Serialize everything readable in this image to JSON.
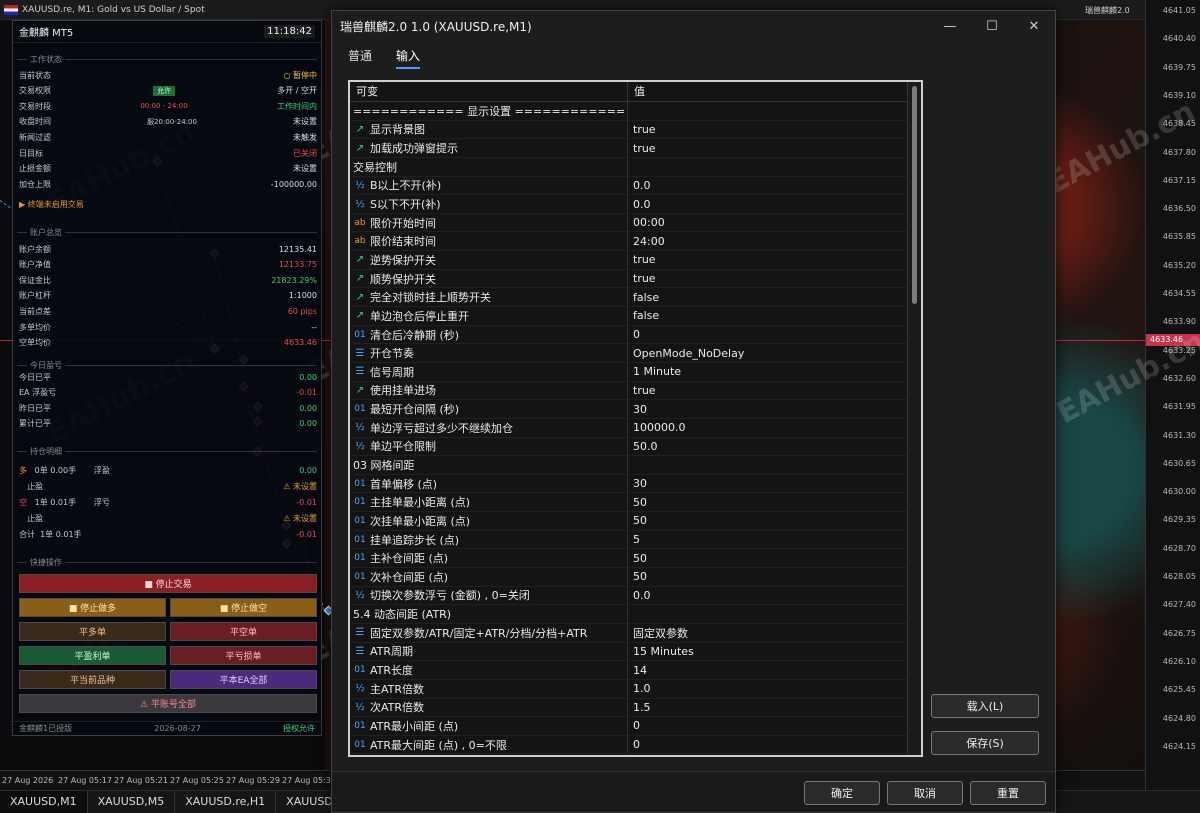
{
  "mt5": {
    "chart_title": "XAUUSD.re, M1:  Gold vs US Dollar / Spot",
    "corner_label": "瑞兽麒麟2.0",
    "prices": [
      "4641.05",
      "4640.40",
      "4639.75",
      "4639.10",
      "4638.45",
      "4637.80",
      "4637.15",
      "4636.50",
      "4635.85",
      "4635.20",
      "4634.55",
      "4633.90",
      "4633.25",
      "4632.60",
      "4631.95",
      "4631.30",
      "4630.65",
      "4630.00",
      "4629.35",
      "4628.70",
      "4628.05",
      "4627.40",
      "4626.75",
      "4626.10",
      "4625.45",
      "4624.80",
      "4624.15"
    ],
    "current_price": "4633.46",
    "times": [
      "27 Aug 2026",
      "27 Aug 05:17",
      "27 Aug 05:21",
      "27 Aug 05:25",
      "27 Aug 05:29",
      "27 Aug 05:3"
    ],
    "symbol_tabs": [
      "XAUUSD,M1",
      "XAUUSD,M5",
      "XAUUSD.re,H1",
      "XAUUSD."
    ],
    "watermark": "EAHub.cn"
  },
  "panel": {
    "name": "金麒麟 MT5",
    "time": "11:18:42",
    "sec_work": "工作状态",
    "sec_account": "账户总览",
    "sec_today": "今日盈亏",
    "sec_hold": "持仓明细",
    "sec_quick": "快捷操作",
    "work": [
      {
        "k": "当前状态",
        "v": "○ 暂停中",
        "cls": "y"
      },
      {
        "k": "交易权限",
        "v": "多开 / 空开",
        "tag": "允许"
      },
      {
        "k": "交易时段",
        "v": "工作时间内",
        "mid": "00:00 - 24:00",
        "cls": "g"
      },
      {
        "k": "收盘时间",
        "v": "未设置",
        "mid": "服20:00-24:00"
      },
      {
        "k": "新闻过滤",
        "v": "未触发"
      },
      {
        "k": "日目标",
        "v": "已关闭",
        "cls": "r"
      },
      {
        "k": "止损金额",
        "v": "未设置"
      },
      {
        "k": "加仓上限",
        "v": "-100000.00"
      }
    ],
    "terminal_note": "▶ 终端未启用交易",
    "account": [
      {
        "k": "账户余额",
        "v": "12135.41"
      },
      {
        "k": "账户净值",
        "v": "12133.75",
        "cls": "r"
      },
      {
        "k": "保证金比",
        "v": "21823.29%",
        "cls": "g"
      },
      {
        "k": "账户杠杆",
        "v": "1:1000"
      },
      {
        "k": "当前点差",
        "v": "60 pips",
        "cls": "r"
      },
      {
        "k": "多单均价",
        "v": "--"
      },
      {
        "k": "空单均价",
        "v": "4633.46",
        "cls": "r"
      }
    ],
    "today": [
      {
        "k": "今日已平",
        "v": "0.00",
        "cls": "g"
      },
      {
        "k": "EA 浮盈亏",
        "v": "-0.01",
        "cls": "r"
      },
      {
        "k": "昨日已平",
        "v": "0.00",
        "cls": "g"
      },
      {
        "k": "累计已平",
        "v": "0.00",
        "cls": "g"
      }
    ],
    "hold_long": {
      "label": "多",
      "count": "0单",
      "lots": "0.00手",
      "float": "浮盈",
      "val": "0.00",
      "sl": "止盈",
      "warn": "⚠ 未设置"
    },
    "hold_short": {
      "label": "空",
      "count": "1单",
      "lots": "0.01手",
      "float": "浮亏",
      "val": "-0.01",
      "sl": "止盈",
      "warn": "⚠ 未设置"
    },
    "hold_total": {
      "label": "合计",
      "count": "1单",
      "lots": "0.01手",
      "val": "-0.01"
    },
    "buttons": {
      "stop_trade": "■ 停止交易",
      "stop_long": "■ 停止做多",
      "stop_short": "■ 停止做空",
      "close_long": "平多单",
      "close_short": "平空单",
      "close_profit": "平盈利单",
      "close_loss": "平亏损单",
      "close_current": "平当前品种",
      "close_ea": "平本EA全部",
      "close_all": "⚠ 平账号全部"
    },
    "footer_left": "金麒麟1已授版",
    "footer_mid": "2026-08-27",
    "footer_right": "授权允许"
  },
  "dialog": {
    "title": "瑞兽麒麟2.0 1.0 (XAUUSD.re,M1)",
    "tabs": [
      "普通",
      "输入"
    ],
    "col_var": "可变",
    "col_val": "值",
    "rows": [
      {
        "icon": "",
        "name": "============ 显示设置 ============",
        "value": ""
      },
      {
        "icon": "bool",
        "name": "显示背景图",
        "value": "true"
      },
      {
        "icon": "bool",
        "name": "加载成功弹窗提示",
        "value": "true"
      },
      {
        "icon": "",
        "name": "交易控制",
        "value": ""
      },
      {
        "icon": "dbl",
        "name": "B以上不开(补)",
        "value": "0.0"
      },
      {
        "icon": "dbl",
        "name": "S以下不开(补)",
        "value": "0.0"
      },
      {
        "icon": "str",
        "name": "限价开始时间",
        "value": "00:00"
      },
      {
        "icon": "str",
        "name": "限价结束时间",
        "value": "24:00"
      },
      {
        "icon": "bool",
        "name": "逆势保护开关",
        "value": "true"
      },
      {
        "icon": "bool",
        "name": "顺势保护开关",
        "value": "true"
      },
      {
        "icon": "bool",
        "name": "完全对锁时挂上顺势开关",
        "value": "false"
      },
      {
        "icon": "bool",
        "name": "单边泡仓后停止重开",
        "value": "false"
      },
      {
        "icon": "num",
        "name": "清仓后冷静期 (秒)",
        "value": "0"
      },
      {
        "icon": "enum",
        "name": "开仓节奏",
        "value": "OpenMode_NoDelay"
      },
      {
        "icon": "enum",
        "name": "信号周期",
        "value": "1 Minute"
      },
      {
        "icon": "bool",
        "name": "使用挂单进场",
        "value": "true"
      },
      {
        "icon": "num",
        "name": "最短开仓间隔 (秒)",
        "value": "30"
      },
      {
        "icon": "dbl",
        "name": "单边浮亏超过多少不继续加仓",
        "value": "100000.0"
      },
      {
        "icon": "dbl",
        "name": "单边平仓限制",
        "value": "50.0"
      },
      {
        "icon": "",
        "name": "03 网格间距",
        "value": ""
      },
      {
        "icon": "num",
        "name": "首单偏移 (点)",
        "value": "30"
      },
      {
        "icon": "num",
        "name": "主挂单最小距离 (点)",
        "value": "50"
      },
      {
        "icon": "num",
        "name": "次挂单最小距离 (点)",
        "value": "50"
      },
      {
        "icon": "num",
        "name": "挂单追踪步长 (点)",
        "value": "5"
      },
      {
        "icon": "num",
        "name": "主补仓间距 (点)",
        "value": "50"
      },
      {
        "icon": "num",
        "name": "次补仓间距 (点)",
        "value": "50"
      },
      {
        "icon": "dbl",
        "name": "切换次参数浮亏 (金额) , 0=关闭",
        "value": "0.0"
      },
      {
        "icon": "",
        "name": "5.4 动态间距 (ATR)",
        "value": ""
      },
      {
        "icon": "enum",
        "name": "固定双参数/ATR/固定+ATR/分档/分档+ATR",
        "value": "固定双参数"
      },
      {
        "icon": "enum",
        "name": "ATR周期",
        "value": "15 Minutes"
      },
      {
        "icon": "num",
        "name": "ATR长度",
        "value": "14"
      },
      {
        "icon": "dbl",
        "name": "主ATR倍数",
        "value": "1.0"
      },
      {
        "icon": "dbl",
        "name": "次ATR倍数",
        "value": "1.5"
      },
      {
        "icon": "num",
        "name": "ATR最小间距 (点)",
        "value": "0"
      },
      {
        "icon": "num",
        "name": "ATR最大间距 (点) , 0=不限",
        "value": "0"
      }
    ],
    "load_btn": "载入(L)",
    "save_btn": "保存(S)",
    "ok_btn": "确定",
    "cancel_btn": "取消",
    "reset_btn": "重置"
  },
  "icons": {
    "bool": "↗",
    "num": "01",
    "dbl": "½",
    "str": "ab",
    "enum": "☰"
  }
}
